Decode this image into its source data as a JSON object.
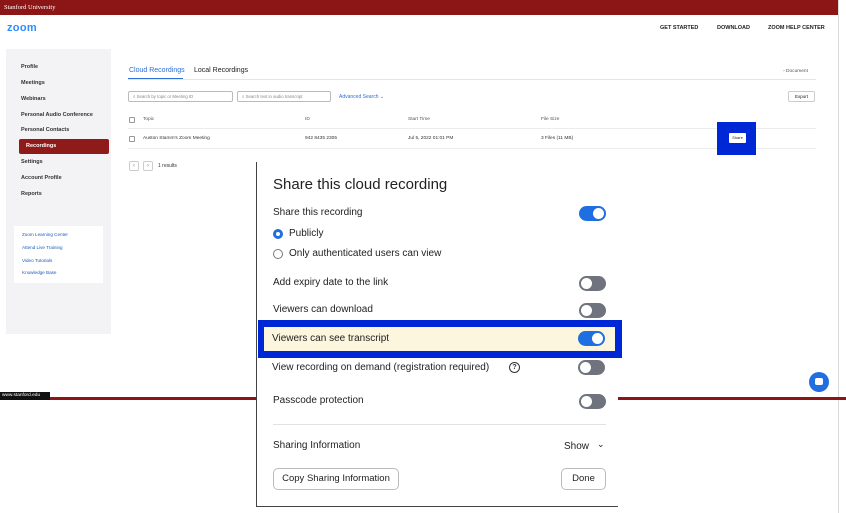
{
  "header": {
    "org_name": "Stanford University",
    "logo": "zoom",
    "nav": [
      "GET STARTED",
      "DOWNLOAD",
      "ZOOM HELP CENTER"
    ]
  },
  "sidebar": {
    "items": [
      "Profile",
      "Meetings",
      "Webinars",
      "Personal Audio Conference",
      "Personal Contacts",
      "Recordings",
      "Settings",
      "Account Profile",
      "Reports"
    ],
    "active": "Recordings",
    "links": [
      "Zoom Learning Center",
      "Attend Live Training",
      "Video Tutorials",
      "Knowledge Base"
    ]
  },
  "tabs": [
    "Cloud Recordings",
    "Local Recordings"
  ],
  "document_link": "Document",
  "search": {
    "topic_placeholder": "Search by topic or Meeting ID",
    "transcript_placeholder": "Search text in audio transcript"
  },
  "advanced_search": "Advanced Search",
  "export_label": "Export",
  "table": {
    "headers": [
      "Topic",
      "ID",
      "Start Time",
      "File Size"
    ],
    "rows": [
      {
        "topic": "Auston Stamm's Zoom Meeting",
        "id": "942 8435 2305",
        "start_time": "Jul 5, 2022 01:01 PM",
        "file_size": "3 Files (11 MB)",
        "action": "Share"
      }
    ]
  },
  "pagination": {
    "prev": "‹",
    "next": "›",
    "results": "1 results"
  },
  "footer": {
    "url": "www.stanford.edu"
  },
  "modal": {
    "title": "Share this cloud recording",
    "share_recording_label": "Share this recording",
    "share_recording_on": true,
    "options": [
      "Publicly",
      "Only authenticated users can view"
    ],
    "selected_option": "Publicly",
    "settings": [
      {
        "label": "Add expiry date to the link",
        "on": false
      },
      {
        "label": "Viewers can download",
        "on": false
      },
      {
        "label": "Viewers can see transcript",
        "on": true
      },
      {
        "label": "View recording on demand (registration required)",
        "on": false
      },
      {
        "label": "Passcode protection",
        "on": false
      }
    ],
    "help_icon_glyph": "?",
    "sharing_info_label": "Sharing Information",
    "show_label": "Show",
    "copy_button": "Copy Sharing Information",
    "done_button": "Done"
  },
  "colors": {
    "stanford_red": "#8c1515",
    "zoom_blue": "#2d8cff",
    "toggle_on": "#1f6fe0",
    "toggle_off": "#6e737d",
    "highlight_box": "#0027d6",
    "highlight_fill": "#fbf6dd"
  }
}
